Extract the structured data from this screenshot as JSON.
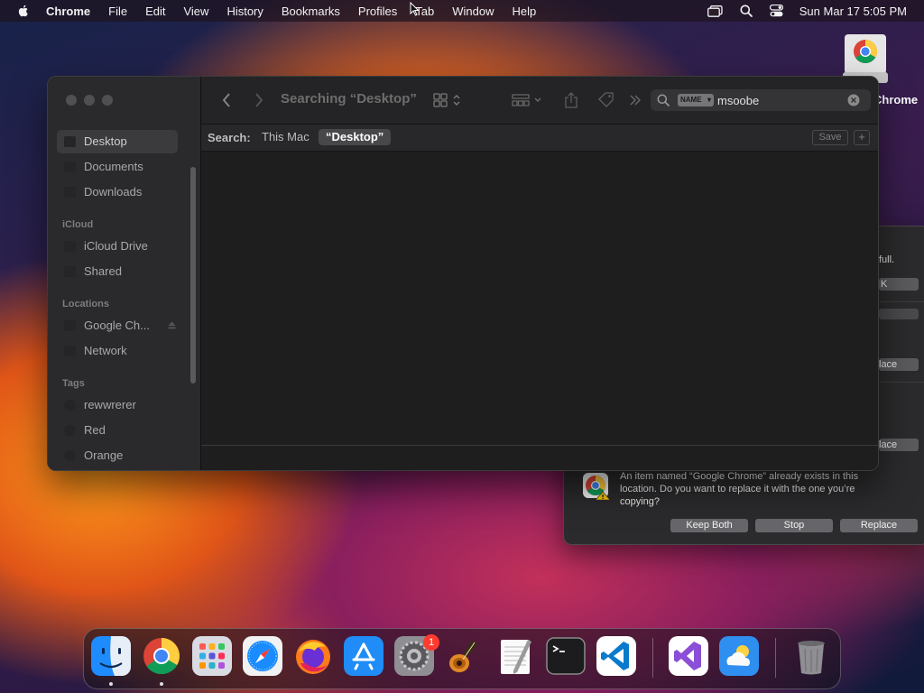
{
  "menubar": {
    "app_name": "Chrome",
    "items": [
      "File",
      "Edit",
      "View",
      "History",
      "Bookmarks",
      "Profiles",
      "Tab",
      "Window",
      "Help"
    ],
    "clock": "Sun Mar 17  5:05 PM"
  },
  "desktop_icon": {
    "label": "Chrome"
  },
  "finder": {
    "title": "Searching “Desktop”",
    "search": {
      "token": "NAME",
      "value": "msoobe"
    },
    "scope": {
      "label": "Search:",
      "this_mac": "This Mac",
      "desktop": "“Desktop”"
    },
    "save_label": "Save",
    "add_label": "+",
    "sidebar": {
      "favorites": [
        "Desktop",
        "Documents",
        "Downloads"
      ],
      "icloud_header": "iCloud",
      "icloud": [
        "iCloud Drive",
        "Shared"
      ],
      "locations_header": "Locations",
      "locations": [
        "Google Ch...",
        "Network"
      ],
      "tags_header": "Tags",
      "tags": [
        "rewwrerer",
        "Red",
        "Orange"
      ]
    }
  },
  "background_dialog": {
    "fragments": [
      "full.",
      "K",
      "lace",
      "lace"
    ]
  },
  "alert": {
    "message": "An item named “Google Chrome” already exists in this location. Do you want to replace it with the one you’re copying?",
    "buttons": {
      "keep_both": "Keep Both",
      "stop": "Stop",
      "replace": "Replace"
    }
  },
  "dock": {
    "apps": [
      "finder-icon",
      "chrome-icon",
      "launchpad-icon",
      "safari-icon",
      "firefox-icon",
      "app-store-icon",
      "system-settings-icon",
      "garageband-icon",
      "textedit-icon",
      "terminal-icon",
      "vscode-icon",
      "visual-studio-icon",
      "weather-icon",
      "trash-icon"
    ],
    "settings_badge": "1"
  }
}
